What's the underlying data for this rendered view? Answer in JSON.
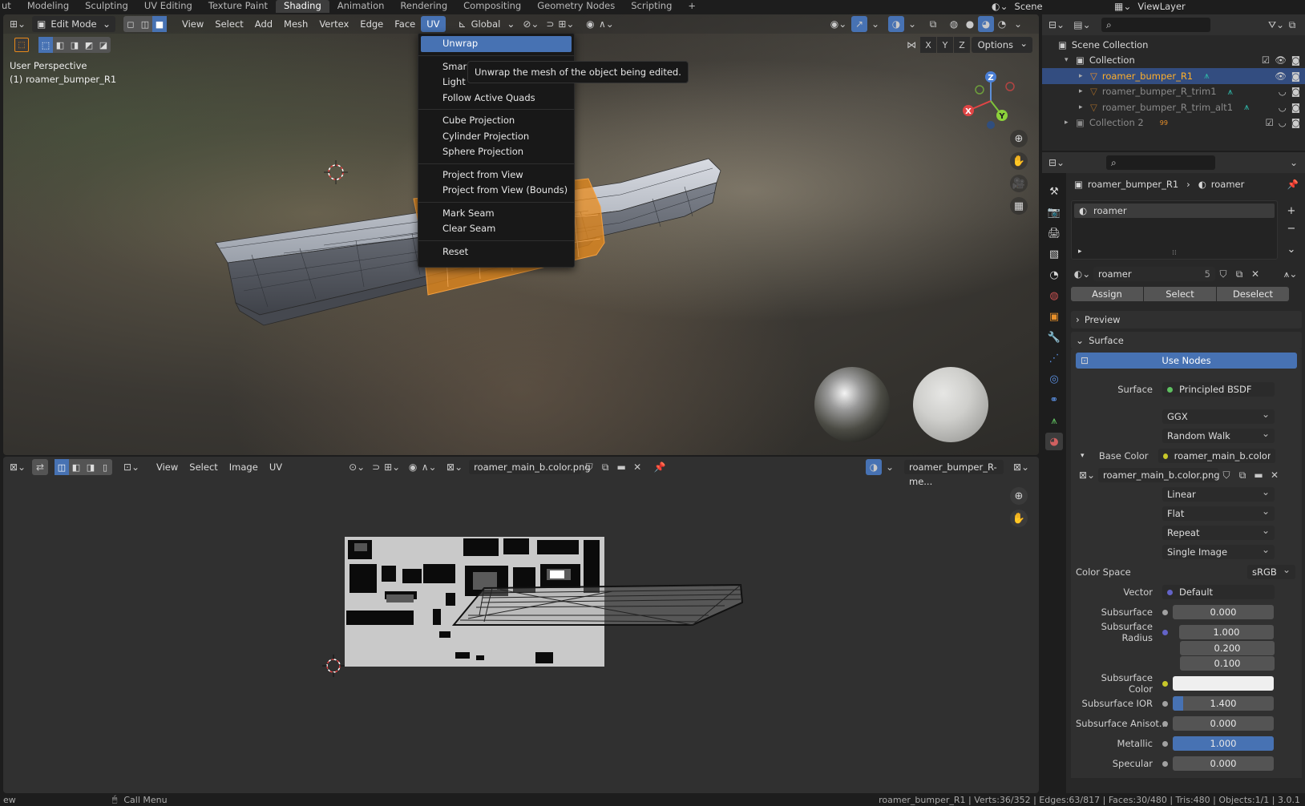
{
  "topbar": {
    "tabs": [
      "ut",
      "Modeling",
      "Sculpting",
      "UV Editing",
      "Texture Paint",
      "Shading",
      "Animation",
      "Rendering",
      "Compositing",
      "Geometry Nodes",
      "Scripting"
    ],
    "active_tab": "Shading",
    "add_tab": "+",
    "scene": "Scene",
    "view_layer": "ViewLayer"
  },
  "viewport": {
    "mode": "Edit Mode",
    "menus": [
      "View",
      "Select",
      "Add",
      "Mesh",
      "Vertex",
      "Edge",
      "Face",
      "UV"
    ],
    "active_menu": "UV",
    "transform_orientation": "Global",
    "perspective": "User Perspective",
    "object_label": "(1) roamer_bumper_R1",
    "options": "Options",
    "axes": [
      "X",
      "Y",
      "Z"
    ],
    "gizmo_axes": {
      "x": "X",
      "y": "Y",
      "z": "Z"
    }
  },
  "uv_menu": {
    "items": [
      {
        "label": "Unwrap",
        "highlight": true
      },
      {
        "label": "Smar",
        "sep_before": true
      },
      {
        "label": "Light"
      },
      {
        "label": "Follow Active Quads"
      },
      {
        "label": "Cube Projection",
        "sep_before": true
      },
      {
        "label": "Cylinder Projection"
      },
      {
        "label": "Sphere Projection"
      },
      {
        "label": "Project from View",
        "sep_before": true
      },
      {
        "label": "Project from View (Bounds)"
      },
      {
        "label": "Mark Seam",
        "sep_before": true
      },
      {
        "label": "Clear Seam"
      },
      {
        "label": "Reset",
        "sep_before": true
      }
    ],
    "tooltip": "Unwrap the mesh of the object being edited."
  },
  "uv_editor": {
    "menus": [
      "View",
      "Select",
      "Image",
      "UV"
    ],
    "image_name": "roamer_main_b.color.png",
    "object_name": "roamer_bumper_R-me..."
  },
  "outliner": {
    "root": "Scene Collection",
    "rows": [
      {
        "label": "Collection",
        "indent": 1,
        "type": "collection"
      },
      {
        "label": "roamer_bumper_R1",
        "indent": 2,
        "type": "mesh",
        "selected": true
      },
      {
        "label": "roamer_bumper_R_trim1",
        "indent": 2,
        "type": "mesh",
        "dim": true
      },
      {
        "label": "roamer_bumper_R_trim_alt1",
        "indent": 2,
        "type": "mesh",
        "dim": true
      },
      {
        "label": "Collection 2",
        "indent": 1,
        "type": "collection",
        "dim": true,
        "badge": "99"
      }
    ]
  },
  "properties": {
    "breadcrumb_object": "roamer_bumper_R1",
    "breadcrumb_material": "roamer",
    "slot_name": "roamer",
    "material_name": "roamer",
    "user_count": "5",
    "assign": "Assign",
    "select": "Select",
    "deselect": "Deselect",
    "preview": "Preview",
    "surface_panel": "Surface",
    "use_nodes": "Use Nodes",
    "surface_label": "Surface",
    "surface_value": "Principled BSDF",
    "distribution": "GGX",
    "subsurface_method": "Random Walk",
    "base_color_label": "Base Color",
    "base_color_value": "roamer_main_b.color.pn",
    "image_name": "roamer_main_b.color.png",
    "interpolation": "Linear",
    "projection": "Flat",
    "extension": "Repeat",
    "source": "Single Image",
    "color_space_label": "Color Space",
    "color_space": "sRGB",
    "vector_label": "Vector",
    "vector_value": "Default",
    "subsurface_label": "Subsurface",
    "subsurface_value": "0.000",
    "subsurface_radius_label": "Subsurface Radius",
    "subsurface_radius": [
      "1.000",
      "0.200",
      "0.100"
    ],
    "subsurface_color_label": "Subsurface Color",
    "subsurface_ior_label": "Subsurface IOR",
    "subsurface_ior": "1.400",
    "subsurface_ior_fill": 0.1,
    "subsurface_aniso_label": "Subsurface Anisot...",
    "subsurface_aniso": "0.000",
    "metallic_label": "Metallic",
    "metallic": "1.000",
    "metallic_fill": 1.0,
    "specular_label": "Specular",
    "specular": "0.000"
  },
  "statusbar": {
    "left": "ew",
    "call_menu": "Call Menu",
    "stats": "roamer_bumper_R1 | Verts:36/352 | Edges:63/817 | Faces:30/480 | Tris:480 | Objects:1/1 | 3.0.1"
  },
  "colors": {
    "accent": "#4772b3",
    "selection_orange": "#e88a1a",
    "outliner_selected_text": "#ffaf29"
  }
}
